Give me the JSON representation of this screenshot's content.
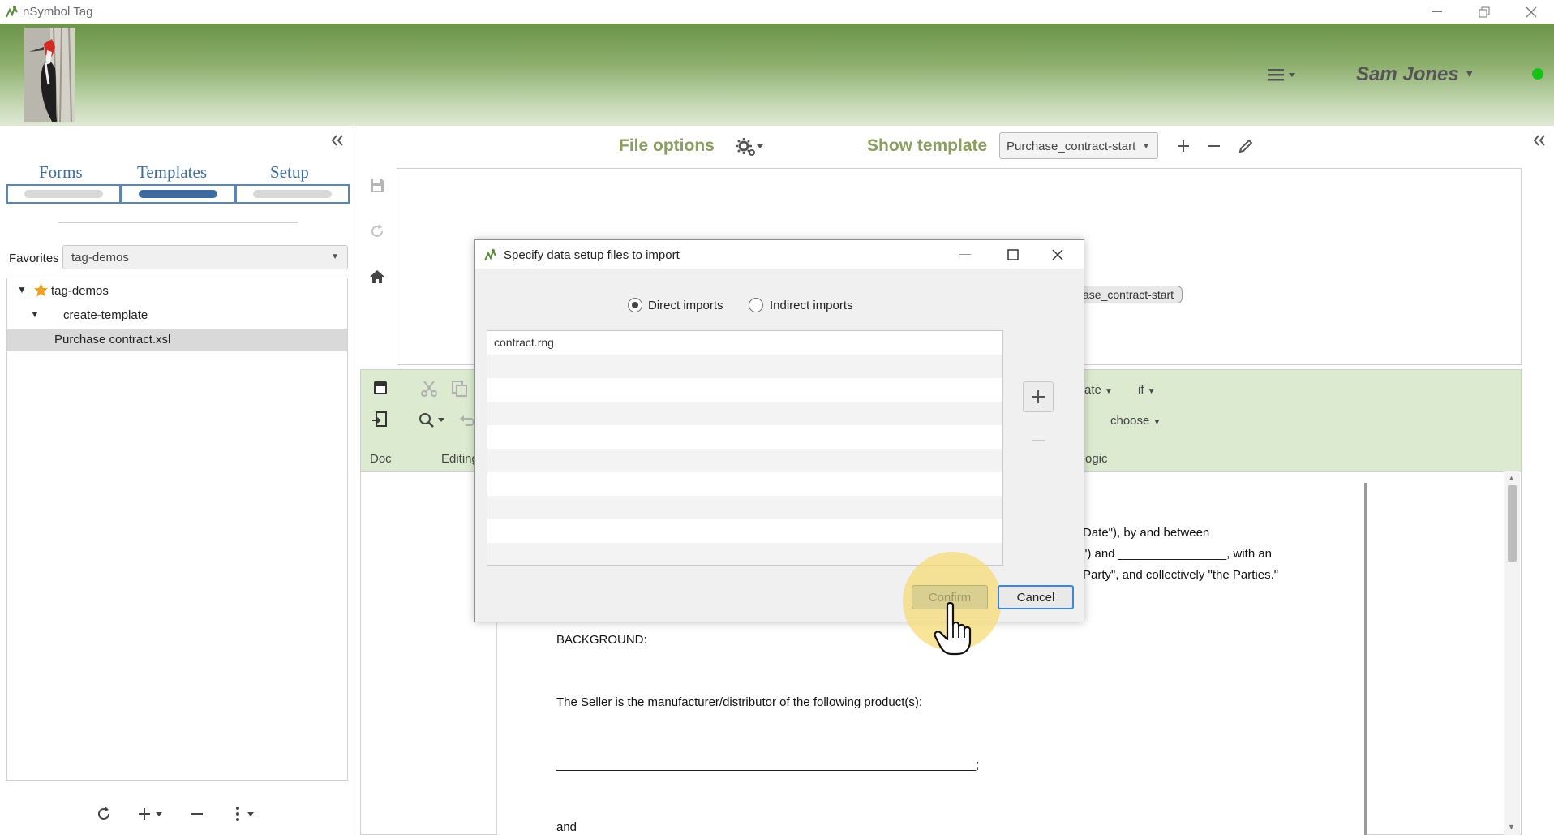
{
  "app": {
    "title": "nSymbol Tag"
  },
  "header": {
    "user_name": "Sam Jones"
  },
  "left": {
    "tabs": [
      {
        "label": "Forms"
      },
      {
        "label": "Templates"
      },
      {
        "label": "Setup"
      }
    ],
    "favorites_label": "Favorites",
    "favorites_value": "tag-demos",
    "tree": {
      "root": "tag-demos",
      "child": "create-template",
      "leaf": "Purchase contract.xsl"
    }
  },
  "main": {
    "file_options": "File options",
    "show_template": "Show template",
    "template_value": "Purchase_contract-start",
    "template_chip": "ase_contract-start",
    "ribbon": {
      "doc_label": "Doc",
      "editing_label": "Editing",
      "logic_label": "ogic",
      "ate_label": "ate",
      "if_label": "if",
      "choose_label": "choose"
    },
    "document": {
      "line1": "Date\"), by and between",
      "line2": "\") and ________________, with an",
      "line3": "Party\", and collectively \"the Parties.\"",
      "background": "BACKGROUND:",
      "seller": "The Seller is the manufacturer/distributor of the following product(s):",
      "blank": "______________________________________________________________;",
      "and": "and"
    }
  },
  "dialog": {
    "title": "Specify data setup files to import",
    "radio_direct": "Direct imports",
    "radio_indirect": "Indirect imports",
    "selected": "Direct imports",
    "files": [
      "contract.rng"
    ],
    "confirm_label": "Confirm",
    "cancel_label": "Cancel"
  },
  "colors": {
    "accent_green": "#8a9e5e",
    "tab_blue": "#3c6d9e",
    "online": "#15c315"
  }
}
